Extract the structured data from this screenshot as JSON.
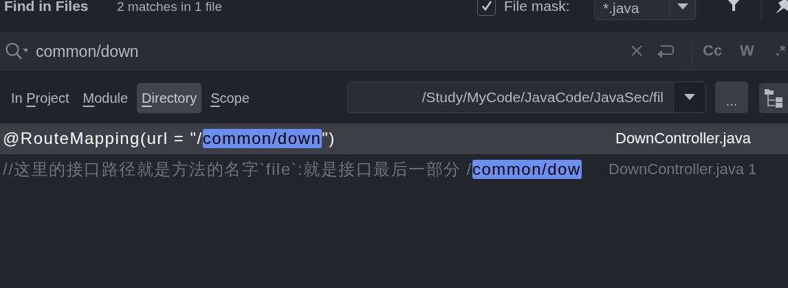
{
  "header": {
    "title": "Find in Files",
    "summary": "2 matches in 1 file",
    "file_mask": {
      "checked": true,
      "label": "File mask:",
      "value": "*.java"
    }
  },
  "search": {
    "value": "common/down",
    "options": [
      "Cc",
      "W",
      ".*"
    ]
  },
  "scopes": [
    {
      "pre": "In ",
      "key": "P",
      "post": "roject",
      "selected": false
    },
    {
      "key": "M",
      "post": "odule",
      "selected": false
    },
    {
      "key": "D",
      "post": "irectory",
      "selected": true
    },
    {
      "key": "S",
      "post": "cope",
      "selected": false
    }
  ],
  "directory": {
    "value": "/Study/MyCode/JavaCode/JavaSec/fil",
    "browse": "..."
  },
  "results": [
    {
      "before": "@RouteMapping(url = \"/",
      "match": "common/down",
      "after": "\")",
      "file": "DownController.java",
      "selected": true
    },
    {
      "before": "//这里的接口路径就是方法的名字`file`:就是接口最后一部分  /",
      "match": "common/dow",
      "file": "DownController.java 1",
      "selected": false
    }
  ]
}
